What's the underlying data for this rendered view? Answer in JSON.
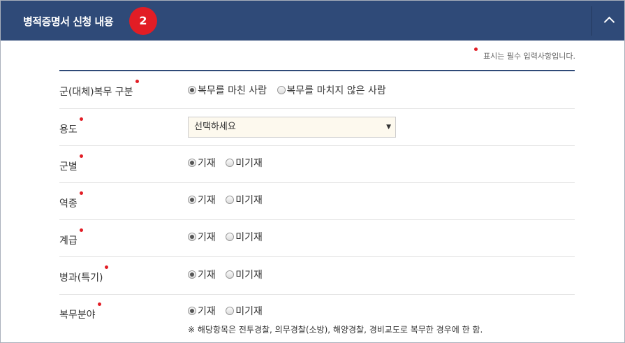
{
  "header": {
    "title": "병적증명서 신청 내용",
    "step": "2",
    "toggle_icon": "chevron-up-icon"
  },
  "required_note": "표시는 필수 입력사항입니다.",
  "colors": {
    "header_bg": "#2f4a78",
    "accent_red": "#e21d25",
    "select_bg": "#fdf9ee"
  },
  "rows": [
    {
      "label": "군(대체)복무 구분",
      "options": [
        "복무를 마친 사람",
        "복무를 마치지 않은 사람"
      ],
      "selected": 0
    },
    {
      "label": "용도",
      "select": {
        "value": "선택하세요",
        "arrow": "▼"
      }
    },
    {
      "label": "군별",
      "options": [
        "기재",
        "미기재"
      ],
      "selected": 0
    },
    {
      "label": "역종",
      "options": [
        "기재",
        "미기재"
      ],
      "selected": 0
    },
    {
      "label": "계급",
      "options": [
        "기재",
        "미기재"
      ],
      "selected": 0
    },
    {
      "label": "병과(특기)",
      "options": [
        "기재",
        "미기재"
      ],
      "selected": 0
    },
    {
      "label": "복무분야",
      "options": [
        "기재",
        "미기재"
      ],
      "selected": 0,
      "hint": "※ 해당항목은 전투경찰, 의무경찰(소방), 해양경찰, 경비교도로 복무한 경우에 한 함."
    }
  ]
}
